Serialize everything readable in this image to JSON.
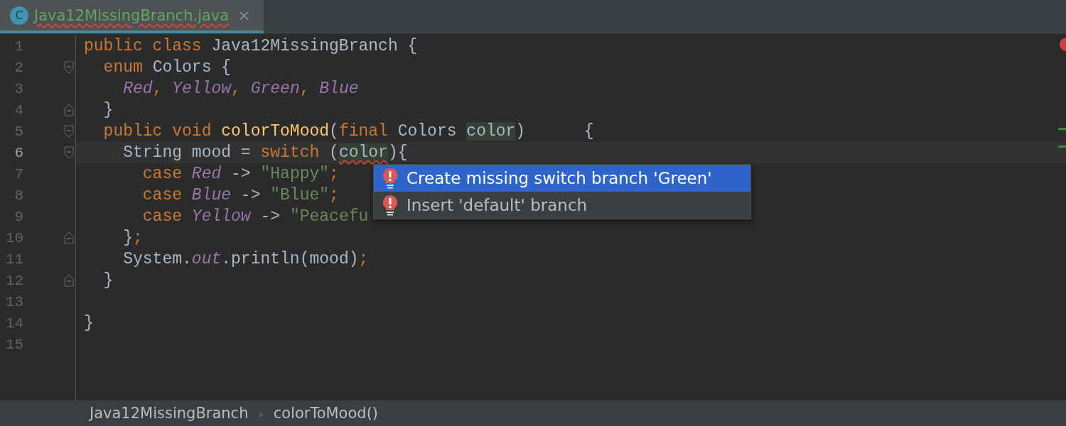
{
  "tabs": [
    {
      "icon_letter": "C",
      "label": "Java12MissingBranch.java",
      "close": "×",
      "selected": true,
      "error": true
    }
  ],
  "editor": {
    "lines": [
      {
        "number": "1",
        "current": false,
        "fold_start": false,
        "fold_end": false,
        "tokens": [
          {
            "kind": "kw",
            "text": "public class "
          },
          {
            "kind": "plain",
            "text": "Java12MissingBranch {"
          }
        ]
      },
      {
        "number": "2",
        "current": false,
        "fold_start": true,
        "fold_end": false,
        "tokens": [
          {
            "kind": "kw",
            "text": "  enum "
          },
          {
            "kind": "plain",
            "text": "Colors {"
          }
        ]
      },
      {
        "number": "3",
        "current": false,
        "fold_start": false,
        "fold_end": false,
        "tokens": [
          {
            "kind": "enum",
            "text": "    Red"
          },
          {
            "kind": "semi",
            "text": ", "
          },
          {
            "kind": "enum",
            "text": "Yellow"
          },
          {
            "kind": "semi",
            "text": ", "
          },
          {
            "kind": "enum",
            "text": "Green"
          },
          {
            "kind": "semi",
            "text": ", "
          },
          {
            "kind": "enum",
            "text": "Blue"
          }
        ]
      },
      {
        "number": "4",
        "current": false,
        "fold_start": false,
        "fold_end": true,
        "tokens": [
          {
            "kind": "plain",
            "text": "  }"
          }
        ]
      },
      {
        "number": "5",
        "current": false,
        "fold_start": true,
        "fold_end": false,
        "tokens": [
          {
            "kind": "kw",
            "text": "  public void "
          },
          {
            "kind": "fn",
            "text": "colorToMood"
          },
          {
            "kind": "plain",
            "text": "("
          },
          {
            "kind": "kw",
            "text": "final "
          },
          {
            "kind": "plain",
            "text": "Colors "
          },
          {
            "kind": "usage",
            "text": "color"
          },
          {
            "kind": "plain",
            "text": ")      {"
          }
        ]
      },
      {
        "number": "6",
        "current": true,
        "fold_start": true,
        "fold_end": false,
        "tokens": [
          {
            "kind": "plain",
            "text": "    String mood = "
          },
          {
            "kind": "kw",
            "text": "switch "
          },
          {
            "kind": "plain",
            "text": "("
          },
          {
            "kind": "usage-error",
            "text": "color"
          },
          {
            "kind": "plain",
            "text": "){"
          }
        ]
      },
      {
        "number": "7",
        "current": false,
        "fold_start": false,
        "fold_end": false,
        "tokens": [
          {
            "kind": "kw",
            "text": "      case "
          },
          {
            "kind": "enum",
            "text": "Red"
          },
          {
            "kind": "plain",
            "text": " -> "
          },
          {
            "kind": "str",
            "text": "\"Happy\""
          },
          {
            "kind": "semi",
            "text": ";"
          }
        ]
      },
      {
        "number": "8",
        "current": false,
        "fold_start": false,
        "fold_end": false,
        "tokens": [
          {
            "kind": "kw",
            "text": "      case "
          },
          {
            "kind": "enum",
            "text": "Blue"
          },
          {
            "kind": "plain",
            "text": " -> "
          },
          {
            "kind": "str",
            "text": "\"Blue\""
          },
          {
            "kind": "semi",
            "text": ";"
          }
        ]
      },
      {
        "number": "9",
        "current": false,
        "fold_start": false,
        "fold_end": false,
        "tokens": [
          {
            "kind": "kw",
            "text": "      case "
          },
          {
            "kind": "enum",
            "text": "Yellow"
          },
          {
            "kind": "plain",
            "text": " -> "
          },
          {
            "kind": "str",
            "text": "\"Peacefu"
          }
        ]
      },
      {
        "number": "10",
        "current": false,
        "fold_start": false,
        "fold_end": true,
        "tokens": [
          {
            "kind": "plain",
            "text": "    }"
          },
          {
            "kind": "semi",
            "text": ";"
          }
        ]
      },
      {
        "number": "11",
        "current": false,
        "fold_start": false,
        "fold_end": false,
        "tokens": [
          {
            "kind": "plain",
            "text": "    System."
          },
          {
            "kind": "field",
            "text": "out"
          },
          {
            "kind": "plain",
            "text": ".println(mood)"
          },
          {
            "kind": "semi",
            "text": ";"
          }
        ]
      },
      {
        "number": "12",
        "current": false,
        "fold_start": false,
        "fold_end": true,
        "tokens": [
          {
            "kind": "plain",
            "text": "  }"
          }
        ]
      },
      {
        "number": "13",
        "current": false,
        "fold_start": false,
        "fold_end": false
      },
      {
        "number": "14",
        "current": false,
        "fold_start": false,
        "fold_end": false,
        "tokens": [
          {
            "kind": "plain",
            "text": "}"
          }
        ]
      },
      {
        "number": "15",
        "current": false,
        "fold_start": false,
        "fold_end": false
      }
    ]
  },
  "intention_popup": {
    "items": [
      {
        "label": "Create missing switch branch 'Green'",
        "selected": true
      },
      {
        "label": "Insert 'default' branch",
        "selected": false
      }
    ]
  },
  "breadcrumbs": [
    {
      "kind": "crumb",
      "text": "Java12MissingBranch"
    },
    {
      "kind": "separator",
      "text": "›"
    },
    {
      "kind": "crumb",
      "text": "colorToMood()"
    }
  ]
}
